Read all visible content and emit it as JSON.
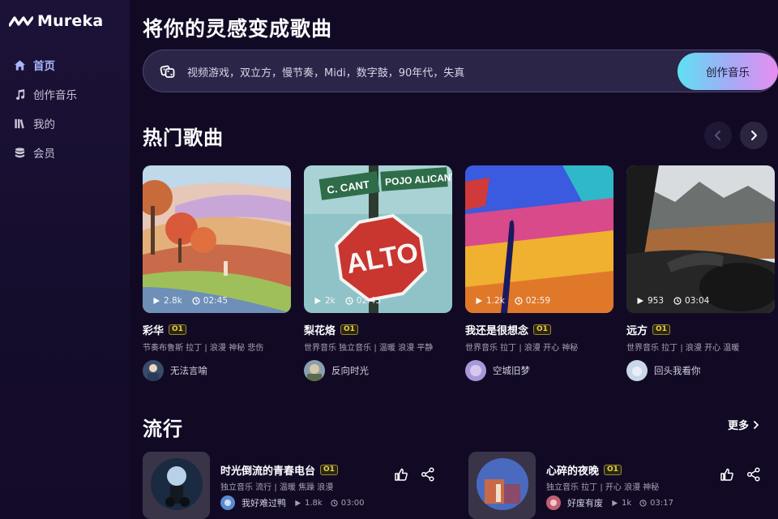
{
  "app": {
    "name": "Mureka"
  },
  "sidebar": {
    "items": [
      {
        "label": "首页",
        "icon": "home-icon",
        "active": true
      },
      {
        "label": "创作音乐",
        "icon": "music-note-icon",
        "active": false
      },
      {
        "label": "我的",
        "icon": "library-icon",
        "active": false
      },
      {
        "label": "会员",
        "icon": "membership-icon",
        "active": false
      }
    ]
  },
  "hero": {
    "title": "将你的灵感变成歌曲",
    "prompt_text": "视频游戏，双立方，慢节奏，Midi，数字鼓，90年代，失真",
    "create_button": "创作音乐"
  },
  "hot": {
    "title": "热门歌曲",
    "songs": [
      {
        "title": "彩华",
        "badge": "O1",
        "plays": "2.8k",
        "duration": "02:45",
        "tags": "节奏布鲁斯 拉丁 | 浪漫 神秘 悲伤",
        "author": "无法言喻"
      },
      {
        "title": "梨花烙",
        "badge": "O1",
        "plays": "2k",
        "duration": "02:43",
        "tags": "世界音乐 独立音乐 | 温暖 浪漫 平静",
        "author": "反向时光"
      },
      {
        "title": "我还是很想念",
        "badge": "O1",
        "plays": "1.2k",
        "duration": "02:59",
        "tags": "世界音乐 拉丁 | 浪漫 开心 神秘",
        "author": "空城旧梦"
      },
      {
        "title": "远方",
        "badge": "O1",
        "plays": "953",
        "duration": "03:04",
        "tags": "世界音乐 拉丁 | 浪漫 开心 温暖",
        "author": "回头我看你"
      }
    ],
    "sign_text": {
      "street1": "C. CANT",
      "street2": "POJO ALICANTE",
      "stop": "ALTO"
    }
  },
  "trending": {
    "title": "流行",
    "more_label": "更多",
    "songs": [
      {
        "title": "时光倒流的青春电台",
        "badge": "O1",
        "tags": "独立音乐 流行 | 温暖 焦躁 浪漫",
        "author": "我好难过鸭",
        "plays": "1.8k",
        "duration": "03:00"
      },
      {
        "title": "心碎的夜晚",
        "badge": "O1",
        "tags": "独立音乐 拉丁 | 开心 浪漫 神秘",
        "author": "好废有废",
        "plays": "1k",
        "duration": "03:17"
      }
    ]
  },
  "colors": {
    "background": "#120a25",
    "accent": "#a9b4ff",
    "badge": "#e8d24a",
    "button_gradient_start": "#5fe0f4",
    "button_gradient_end": "#e78ef0"
  }
}
